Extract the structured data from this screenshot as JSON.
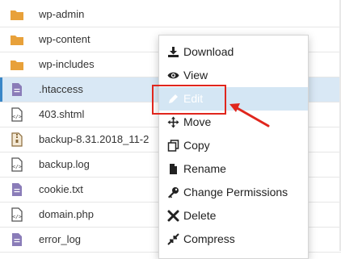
{
  "files": [
    {
      "name": "wp-admin",
      "icon": "folder-icon"
    },
    {
      "name": "wp-content",
      "icon": "folder-icon"
    },
    {
      "name": "wp-includes",
      "icon": "folder-icon"
    },
    {
      "name": ".htaccess",
      "icon": "text-file-icon",
      "selected": true
    },
    {
      "name": "403.shtml",
      "icon": "code-file-icon"
    },
    {
      "name": "backup-8.31.2018_11-2",
      "icon": "archive-file-icon"
    },
    {
      "name": "backup.log",
      "icon": "code-file-icon"
    },
    {
      "name": "cookie.txt",
      "icon": "text-file-icon"
    },
    {
      "name": "domain.php",
      "icon": "code-file-icon"
    },
    {
      "name": "error_log",
      "icon": "text-file-icon"
    }
  ],
  "context_menu": {
    "items": [
      {
        "label": "Download",
        "icon": "download-icon"
      },
      {
        "label": "View",
        "icon": "eye-icon"
      },
      {
        "label": "Edit",
        "icon": "pencil-icon",
        "state": "highlighted"
      },
      {
        "label": "Move",
        "icon": "move-icon"
      },
      {
        "label": "Copy",
        "icon": "copy-icon"
      },
      {
        "label": "Rename",
        "icon": "rename-file-icon"
      },
      {
        "label": "Change Permissions",
        "icon": "key-icon"
      },
      {
        "label": "Delete",
        "icon": "delete-x-icon"
      },
      {
        "label": "Compress",
        "icon": "compress-icon"
      }
    ]
  },
  "colors": {
    "folder": "#e8a13a",
    "selected_row": "#d9e8f5",
    "menu_highlight": "#d4e6f4",
    "annotation": "#e0261d"
  }
}
